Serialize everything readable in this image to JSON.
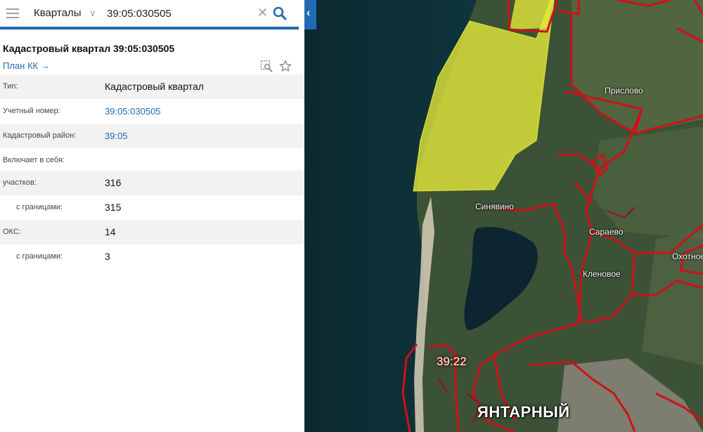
{
  "search": {
    "type_label": "Кварталы",
    "query": "39:05:030505"
  },
  "card": {
    "title": "Кадастровый квартал 39:05:030505",
    "plan_link": "План КК →",
    "rows": [
      {
        "key": "Тип:",
        "value": "Кадастровый квартал",
        "link": false,
        "indent": false
      },
      {
        "key": "Учетный номер:",
        "value": "39:05:030505",
        "link": true,
        "indent": false
      },
      {
        "key": "Кадастровый район:",
        "value": "39:05",
        "link": true,
        "indent": false
      },
      {
        "key": "Включает в себя:",
        "value": "",
        "link": false,
        "indent": false
      },
      {
        "key": "участков:",
        "value": "316",
        "link": false,
        "indent": false
      },
      {
        "key": "с границами:",
        "value": "315",
        "link": false,
        "indent": true
      },
      {
        "key": "ОКС:",
        "value": "14",
        "link": false,
        "indent": false
      },
      {
        "key": "с границами:",
        "value": "3",
        "link": false,
        "indent": true
      }
    ]
  },
  "map": {
    "labels": {
      "prislovo": "Прислово",
      "sinyavino": "Синявино",
      "saraevo": "Сараево",
      "okhotnoe": "Охотное",
      "klenovoe": "Кленовое",
      "district": "39:22",
      "town": "ЯНТАРНЫЙ"
    },
    "colors": {
      "sea": "#0f2f35",
      "boundary": "#d0101a",
      "highlight": "#e8ec3a",
      "accent": "#1e6bb3"
    }
  }
}
